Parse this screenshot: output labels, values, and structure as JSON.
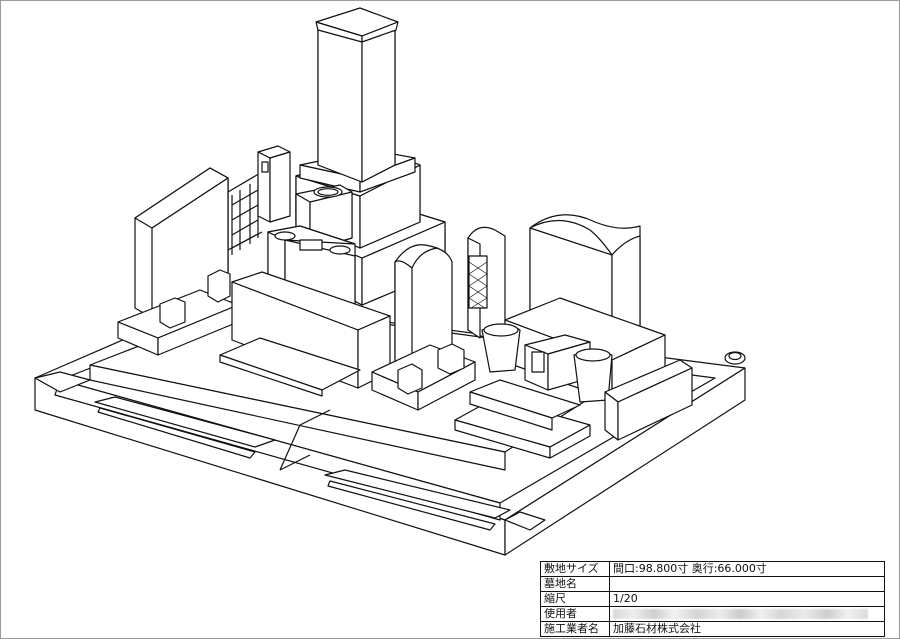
{
  "title_block": {
    "site_size_label": "敷地サイズ",
    "site_size_value": "間口:98.800寸 奥行:66.000寸",
    "grave_name_label": "墓地名",
    "grave_name_value": "",
    "scale_label": "縮尺",
    "scale_value": "1/20",
    "user_label": "使用者",
    "user_value": "",
    "contractor_label": "施工業者名",
    "contractor_value": "加藤石材株式会社"
  }
}
